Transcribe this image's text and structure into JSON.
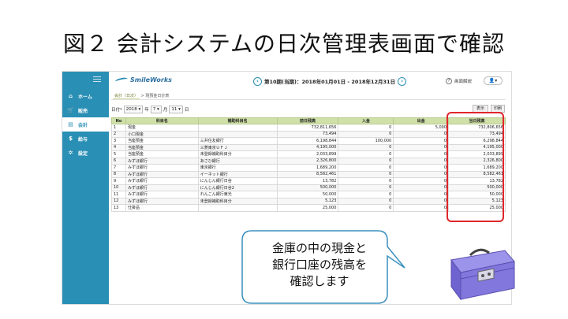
{
  "slide": {
    "title": "図２ 会計システムの日次管理表画面で確認",
    "callout_lines": [
      "金庫の中の現金と",
      "銀行口座の残高を",
      "確認します"
    ]
  },
  "app": {
    "logo_text": "SmileWorks",
    "period_text": "第10期(当期)：2018年01月01日 - 2018年12月31日",
    "help_label": "画面解説",
    "user_label": "👤▾",
    "prev_icon": "‹",
    "next_icon": "›"
  },
  "sidebar": {
    "items": [
      {
        "icon": "⌂",
        "label": "ホーム"
      },
      {
        "icon": "🛒",
        "label": "販売"
      },
      {
        "icon": "▤",
        "label": "会計"
      },
      {
        "icon": "$",
        "label": "給与"
      },
      {
        "icon": "✲",
        "label": "設定"
      }
    ]
  },
  "breadcrumb": {
    "link": "会計（日次）",
    "sep": ">",
    "current": "現預金日計表"
  },
  "datebar": {
    "label": "日付*",
    "year": "2018 ▾",
    "year_unit": "年",
    "month": "7 ▾",
    "month_unit": "月",
    "day": "11 ▾",
    "day_unit": "日",
    "show_button": "表示",
    "print_button": "印刷"
  },
  "table": {
    "headers": [
      "No",
      "科目名",
      "補助科目名",
      "前日残高",
      "入金",
      "出金",
      "当日残高"
    ],
    "rows": [
      [
        "1",
        "現金",
        "",
        "732,811,656",
        "0",
        "5,000",
        "732,806,656"
      ],
      [
        "2",
        "小口現金",
        "",
        "73,494",
        "0",
        "0",
        "73,494"
      ],
      [
        "3",
        "当座預金",
        "三井住友銀行",
        "6,198,844",
        "100,000",
        "0",
        "6,298,844"
      ],
      [
        "4",
        "当座預金",
        "三菱東京ＵＦＪ",
        "4,195,000",
        "0",
        "0",
        "4,195,000"
      ],
      [
        "5",
        "当座預金",
        "未登録補助科目分",
        "2,033,899",
        "0",
        "0",
        "2,033,899"
      ],
      [
        "6",
        "みずほ銀行",
        "あさひ銀行",
        "2,326,800",
        "0",
        "0",
        "2,326,800"
      ],
      [
        "7",
        "みずほ銀行",
        "東京銀行",
        "1,689,200",
        "0",
        "0",
        "1,689,200"
      ],
      [
        "8",
        "みずほ銀行",
        "イーネット銀行",
        "8,582,461",
        "0",
        "0",
        "8,582,461"
      ],
      [
        "9",
        "みずほ銀行",
        "にんじん銀行日谷",
        "13,782",
        "0",
        "0",
        "13,782"
      ],
      [
        "10",
        "みずほ銀行",
        "にんじん銀行日谷2",
        "500,000",
        "0",
        "0",
        "500,000"
      ],
      [
        "11",
        "みずほ銀行",
        "れんこん銀行東光",
        "50,000",
        "0",
        "0",
        "50,000"
      ],
      [
        "12",
        "みずほ銀行",
        "未登録補助科目分",
        "5,123",
        "0",
        "0",
        "5,123"
      ],
      [
        "13",
        "仕掛品",
        "",
        "25,000",
        "0",
        "0",
        "25,000"
      ]
    ]
  },
  "colors": {
    "sidebar": "#2a8fb5",
    "header_row": "#cfe0a8",
    "highlight": "#e0262b",
    "cashbox": "#7b6fd6"
  }
}
